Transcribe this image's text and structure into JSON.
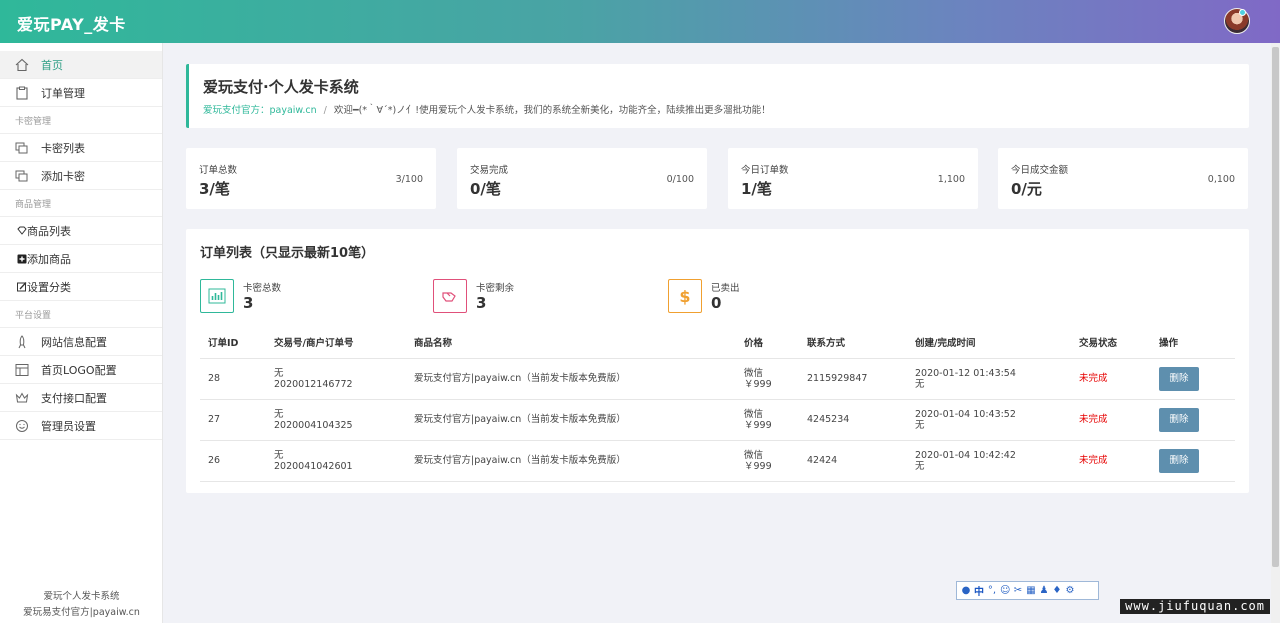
{
  "header": {
    "brand": "爱玩PAY_发卡",
    "gradient": [
      "#2fb89a",
      "#8069c6"
    ]
  },
  "sidebar": {
    "home": "首页",
    "orders": "订单管理",
    "section_card": "卡密管理",
    "card_list": "卡密列表",
    "add_card": "添加卡密",
    "section_goods": "商品管理",
    "goods_list": "商品列表",
    "add_goods": "添加商品",
    "set_category": "设置分类",
    "section_platform": "平台设置",
    "site_config": "网站信息配置",
    "logo_config": "首页LOGO配置",
    "pay_config": "支付接口配置",
    "admin_config": "管理员设置",
    "footer_line1": "爱玩个人发卡系统",
    "footer_line2": "爱玩易支付官方|payaiw.cn"
  },
  "welcome": {
    "title": "爱玩支付·个人发卡系统",
    "link": "爱玩支付官方：payaiw.cn",
    "sep": "/",
    "message": "欢迎━(*｀∀´*)ノ亻!使用爱玩个人发卡系统，我们的系统全新美化，功能齐全，陆续推出更多溜批功能！"
  },
  "stats": [
    {
      "label": "订单总数",
      "value": "3/笔",
      "ratio": "3/100"
    },
    {
      "label": "交易完成",
      "value": "0/笔",
      "ratio": "0/100"
    },
    {
      "label": "今日订单数",
      "value": "1/笔",
      "ratio": "1,100"
    },
    {
      "label": "今日成交金额",
      "value": "0/元",
      "ratio": "0,100"
    }
  ],
  "orders": {
    "title": "订单列表（只显示最新10笔）",
    "mini": [
      {
        "label": "卡密总数",
        "value": "3",
        "color": "#2fb89a",
        "icon": "bar-chart-icon"
      },
      {
        "label": "卡密剩余",
        "value": "3",
        "color": "#e0507a",
        "icon": "hand-icon"
      },
      {
        "label": "已卖出",
        "value": "0",
        "color": "#f0a030",
        "icon": "dollar-icon"
      }
    ],
    "columns": [
      "订单ID",
      "交易号/商户订单号",
      "商品名称",
      "价格",
      "联系方式",
      "创建/完成时间",
      "交易状态",
      "操作"
    ],
    "rows": [
      {
        "id": "28",
        "trade_no": "无",
        "order_no": "2020012146772",
        "goods": "爱玩支付官方|payaiw.cn（当前发卡版本免费版）",
        "pay": "微信",
        "price": "￥999",
        "contact": "2115929847",
        "created": "2020-01-12 01:43:54",
        "finished": "无",
        "status": "未完成",
        "action": "删除"
      },
      {
        "id": "27",
        "trade_no": "无",
        "order_no": "2020004104325",
        "goods": "爱玩支付官方|payaiw.cn（当前发卡版本免费版）",
        "pay": "微信",
        "price": "￥999",
        "contact": "4245234",
        "created": "2020-01-04 10:43:52",
        "finished": "无",
        "status": "未完成",
        "action": "删除"
      },
      {
        "id": "26",
        "trade_no": "无",
        "order_no": "2020041042601",
        "goods": "爱玩支付官方|payaiw.cn（当前发卡版本免费版）",
        "pay": "微信",
        "price": "￥999",
        "contact": "42424",
        "created": "2020-01-04 10:42:42",
        "finished": "无",
        "status": "未完成",
        "action": "删除"
      }
    ]
  },
  "ime": {
    "lang": "中"
  },
  "watermark": "www.jiufuquan.com"
}
